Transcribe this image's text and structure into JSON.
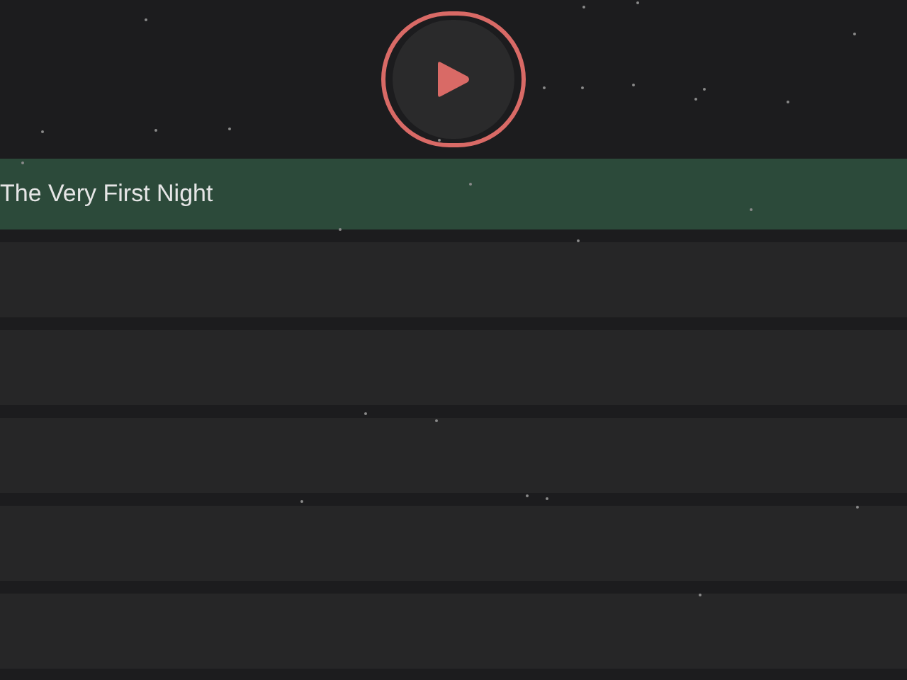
{
  "player": {
    "playing": false
  },
  "tracks": [
    {
      "title": "The Very First Night",
      "selected": true
    },
    {
      "selected": false
    },
    {
      "selected": false
    },
    {
      "selected": false
    },
    {
      "selected": false
    },
    {
      "selected": false
    }
  ]
}
